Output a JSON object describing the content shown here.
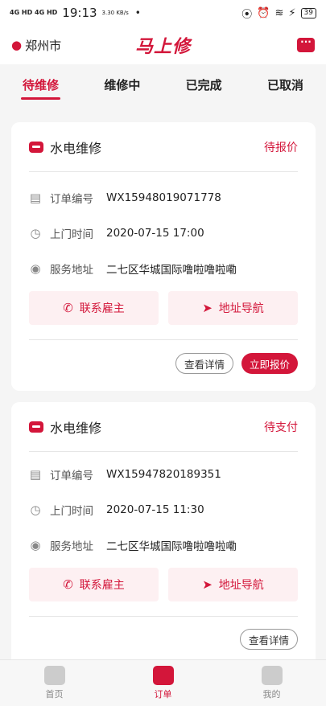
{
  "status_bar": {
    "signal": "4G HD 4G HD",
    "time": "19:13",
    "speed": "3.30 KB/s",
    "dot": "•",
    "battery": "39"
  },
  "header": {
    "city": "郑州市",
    "brand": "马上修"
  },
  "tabs": [
    "待维修",
    "维修中",
    "已完成",
    "已取消"
  ],
  "orders": [
    {
      "title": "水电维修",
      "status": "待报价",
      "order_label": "订单编号",
      "order_no": "WX15948019071778",
      "time_label": "上门时间",
      "time": "2020-07-15 17:00",
      "addr_label": "服务地址",
      "addr": "二七区华城国际噜啦噜啦嘞",
      "contact": "联系雇主",
      "navigate": "地址导航",
      "detail": "查看详情",
      "action": "立即报价"
    },
    {
      "title": "水电维修",
      "status": "待支付",
      "order_label": "订单编号",
      "order_no": "WX15947820189351",
      "time_label": "上门时间",
      "time": "2020-07-15 11:30",
      "addr_label": "服务地址",
      "addr": "二七区华城国际噜啦噜啦嘞",
      "contact": "联系雇主",
      "navigate": "地址导航",
      "detail": "查看详情"
    }
  ],
  "bottom_nav": [
    "首页",
    "订单",
    "我的"
  ]
}
